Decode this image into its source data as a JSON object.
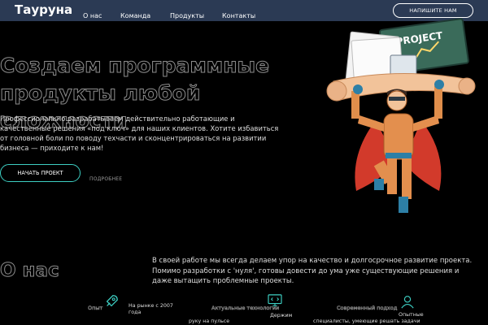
{
  "nav": {
    "logo": "Тауруна",
    "items": [
      "О нас",
      "Команда",
      "Продукты",
      "Контакты"
    ],
    "cta": "НАПИШИТЕ НАМ"
  },
  "hero": {
    "title_line1": "Создаем программные",
    "title_line2": "продукты любой сложности",
    "description": "Профессионально разрабатываем действительно работающие и качественные решения «под ключ» для наших клиентов. Хотите избавиться от головной боли по поводу техчасти и сконцентрироваться на развитии бизнеса — приходите к нам!",
    "start_button": "НАЧАТЬ ПРОЕКТ",
    "more_link": "ПОДРОБНЕЕ",
    "image_board_text": "PROJECT"
  },
  "about": {
    "title": "О нас",
    "text": "В своей работе мы всегда делаем упор на качество и долгосрочное развитие проекта. Помимо разработки с 'нуля', готовы довести до ума уже существующие решения и даже вытащить проблемные проекты.",
    "features": [
      {
        "label": "Опыт",
        "text1": "На рынке с 2007",
        "text2": "года",
        "text3": "руку на пульсе"
      },
      {
        "label": "Актуальные технологии",
        "text1": "Держим",
        "text2": "",
        "text3": ""
      },
      {
        "label": "Современный подход",
        "text1": "Опытные",
        "text2": "специалисты, умеющие решать задачи",
        "text3": ""
      }
    ]
  },
  "colors": {
    "nav_bg": "#2b3a54",
    "accent": "#3dcfc3",
    "background": "#000000"
  }
}
